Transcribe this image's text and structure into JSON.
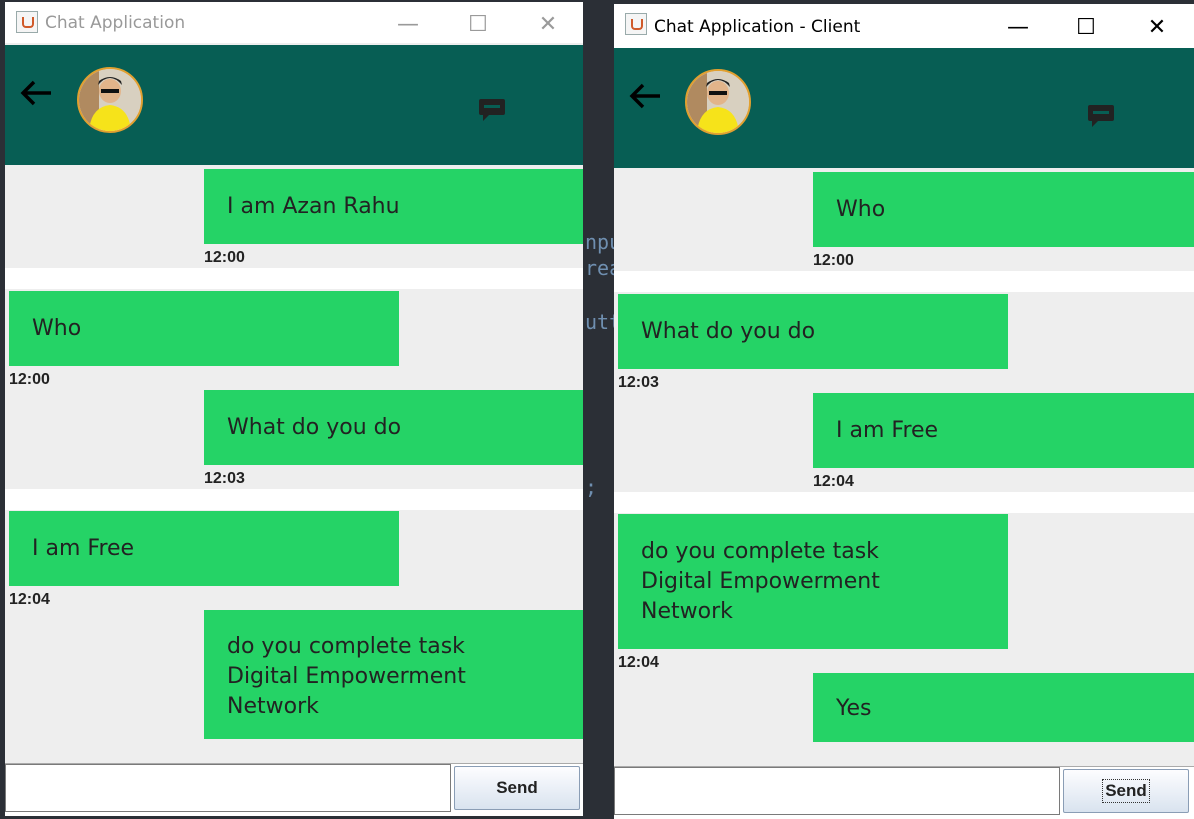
{
  "background_code": [
    "npu",
    "rea",
    "utt",
    ";"
  ],
  "window1": {
    "title": "Chat Application",
    "controls": {
      "minimize": "—",
      "maximize": "☐",
      "close": "✕"
    },
    "back_icon": "back-arrow-icon",
    "messages": [
      {
        "text": "I am Azan Rahu",
        "time": "12:00",
        "side": "right"
      },
      {
        "text": "Who",
        "time": "12:00",
        "side": "left"
      },
      {
        "text": "What do you do",
        "time": "12:03",
        "side": "right"
      },
      {
        "text": "I am Free",
        "time": "12:04",
        "side": "left"
      },
      {
        "text": "do you complete task\nDigital Empowerment\nNetwork",
        "time": "",
        "side": "right"
      }
    ],
    "input_value": "",
    "send_label": "Send"
  },
  "window2": {
    "title": "Chat Application - Client",
    "controls": {
      "minimize": "—",
      "maximize": "☐",
      "close": "✕"
    },
    "back_icon": "back-arrow-icon",
    "messages": [
      {
        "text": "Who",
        "time": "12:00",
        "side": "right"
      },
      {
        "text": "What do you do",
        "time": "12:03",
        "side": "left"
      },
      {
        "text": "I am Free",
        "time": "12:04",
        "side": "right"
      },
      {
        "text": "do you complete task\nDigital Empowerment\nNetwork",
        "time": "12:04",
        "side": "left"
      },
      {
        "text": "Yes",
        "time": "",
        "side": "right"
      }
    ],
    "input_value": "",
    "send_label": "Send"
  },
  "colors": {
    "header": "#075e54",
    "bubble": "#25d366",
    "chat_bg": "#eeeeee"
  }
}
